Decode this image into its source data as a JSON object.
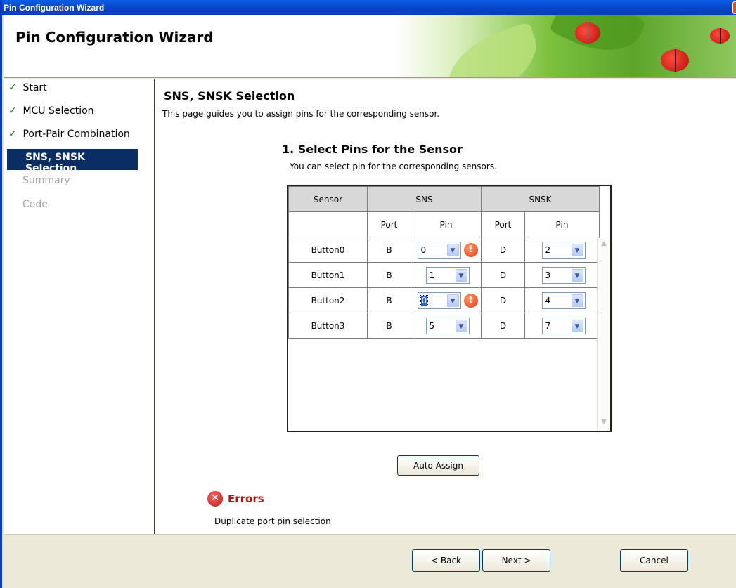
{
  "window": {
    "title": "Pin Configuration Wizard"
  },
  "header": {
    "title": "Pin Configuration Wizard"
  },
  "sidebar": {
    "items": [
      {
        "label": "Start",
        "state": "done"
      },
      {
        "label": "MCU Selection",
        "state": "done"
      },
      {
        "label": "Port-Pair Combination",
        "state": "done"
      },
      {
        "label": "SNS, SNSK Selection",
        "state": "active"
      },
      {
        "label": "Summary",
        "state": "todo"
      },
      {
        "label": "Code",
        "state": "todo"
      }
    ]
  },
  "main": {
    "title": "SNS, SNSK Selection",
    "description": "This page guides you to assign pins for the corresponding sensor.",
    "section": {
      "title": "1. Select Pins for the Sensor",
      "description": "You can select pin for the corresponding sensors."
    },
    "table": {
      "headers": {
        "sensor": "Sensor",
        "sns": "SNS",
        "snsk": "SNSK"
      },
      "subheaders": {
        "port": "Port",
        "pin": "Pin",
        "port2": "Port",
        "pin2": "Pin"
      },
      "rows": [
        {
          "sensor": "Button0",
          "sns_port": "B",
          "sns_pin": "0",
          "snsk_port": "D",
          "snsk_pin": "2"
        },
        {
          "sensor": "Button1",
          "sns_port": "B",
          "sns_pin": "1",
          "snsk_port": "D",
          "snsk_pin": "3"
        },
        {
          "sensor": "Button2",
          "sns_port": "B",
          "sns_pin": "0",
          "snsk_port": "D",
          "snsk_pin": "4"
        },
        {
          "sensor": "Button3",
          "sns_port": "B",
          "sns_pin": "5",
          "snsk_port": "D",
          "snsk_pin": "7"
        }
      ]
    },
    "auto_assign": "Auto Assign",
    "errors": {
      "title": "Errors",
      "message": "Duplicate port pin selection"
    }
  },
  "footer": {
    "back": "< Back",
    "next": "Next >",
    "cancel": "Cancel"
  },
  "colors": {
    "titlebar": "#0842c4",
    "active_nav": "#0a2e63",
    "error": "#b01818",
    "warning": "#e23b10"
  }
}
